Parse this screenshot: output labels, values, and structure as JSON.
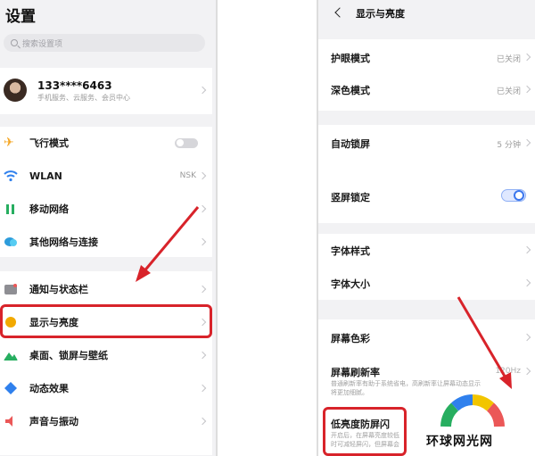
{
  "left": {
    "title": "设置",
    "search_placeholder": "搜索设置项",
    "account": {
      "number": "133****6463",
      "subtitle": "手机服务、云服务、会员中心"
    },
    "items": [
      {
        "label": "飞行模式",
        "icon": "airplane-icon",
        "color": "#f5a623",
        "control": "toggle-off"
      },
      {
        "label": "WLAN",
        "icon": "wifi-icon",
        "color": "#2f80ed",
        "value": "NSK"
      },
      {
        "label": "移动网络",
        "icon": "mobile-network-icon",
        "color": "#27ae60"
      },
      {
        "label": "其他网络与连接",
        "icon": "cloud-link-icon",
        "color": "#2d9cdb"
      },
      {
        "label": "通知与状态栏",
        "icon": "notification-icon",
        "color": "#8e8e93"
      },
      {
        "label": "显示与亮度",
        "icon": "sun-icon",
        "color": "#f2a900"
      },
      {
        "label": "桌面、锁屏与壁纸",
        "icon": "landscape-icon",
        "color": "#27ae60"
      },
      {
        "label": "动态效果",
        "icon": "diamond-icon",
        "color": "#2f80ed"
      },
      {
        "label": "声音与振动",
        "icon": "speaker-icon",
        "color": "#eb5757"
      }
    ]
  },
  "right": {
    "title": "显示与亮度",
    "items": [
      {
        "label": "护眼模式",
        "value": "已关闭"
      },
      {
        "label": "深色模式",
        "value": "已关闭"
      },
      {
        "label": "自动锁屏",
        "value": "5 分钟"
      },
      {
        "label": "竖屏锁定"
      },
      {
        "label": "字体样式"
      },
      {
        "label": "字体大小"
      },
      {
        "label": "屏幕色彩"
      },
      {
        "label": "屏幕刷新率",
        "value": "120Hz",
        "desc": "普通刷新率有助于系统省电，高刷新率让屏幕动态显示将更加细腻。"
      },
      {
        "label": "低亮度防屏闪",
        "desc": "开启后，在屏幕亮度较低时可减轻屏闪，但屏幕会"
      }
    ]
  },
  "watermark": {
    "text": "环球网光网"
  },
  "colors": {
    "highlight": "#d8232a",
    "accent": "#3b77ee"
  }
}
